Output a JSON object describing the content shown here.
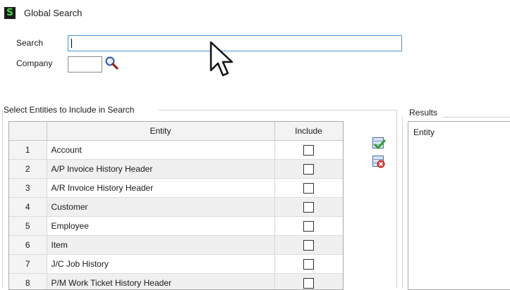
{
  "window": {
    "title": "Global Search",
    "app_icon_glyph": "S"
  },
  "search": {
    "search_label": "Search",
    "search_value": "",
    "company_label": "Company",
    "company_value": ""
  },
  "entities": {
    "group_label": "Select Entities to Include in Search",
    "columns": {
      "num": "",
      "entity": "Entity",
      "include": "Include"
    },
    "rows": [
      {
        "num": "1",
        "entity": "Account",
        "include": false
      },
      {
        "num": "2",
        "entity": "A/P Invoice History Header",
        "include": false
      },
      {
        "num": "3",
        "entity": "A/R Invoice History Header",
        "include": false
      },
      {
        "num": "4",
        "entity": "Customer",
        "include": false
      },
      {
        "num": "5",
        "entity": "Employee",
        "include": false
      },
      {
        "num": "6",
        "entity": "Item",
        "include": false
      },
      {
        "num": "7",
        "entity": "J/C Job History",
        "include": false
      },
      {
        "num": "8",
        "entity": "P/M Work Ticket History Header",
        "include": false
      }
    ]
  },
  "results": {
    "group_label": "Results",
    "column_header": "Entity"
  },
  "icons": {
    "app": "sage-s-icon",
    "lookup": "magnifier-lookup-icon",
    "select_all": "select-all-checkmark-icon",
    "clear_all": "clear-all-icon",
    "cursor": "mouse-pointer-icon"
  },
  "colors": {
    "app_icon_bg": "#1b1b1b",
    "app_icon_fg": "#3fd43f",
    "focus_border": "#4a90d9"
  }
}
